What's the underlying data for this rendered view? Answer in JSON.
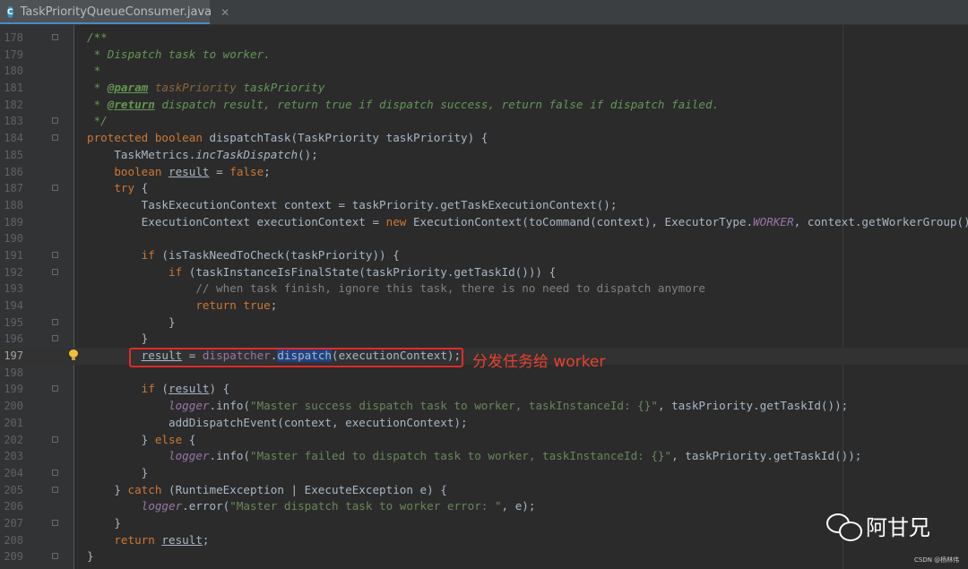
{
  "tab": {
    "icon_letter": "C",
    "file_name": "TaskPriorityQueueConsumer.java",
    "close_glyph": "✕"
  },
  "editor": {
    "current_line": 197,
    "lines": [
      {
        "n": 178,
        "tokens": [
          [
            "doc",
            "/**"
          ]
        ]
      },
      {
        "n": 179,
        "tokens": [
          [
            "doc",
            " * Dispatch task to worker."
          ]
        ]
      },
      {
        "n": 180,
        "tokens": [
          [
            "doc",
            " *"
          ]
        ]
      },
      {
        "n": 181,
        "tokens": [
          [
            "doc",
            " * "
          ],
          [
            "tag",
            "@param"
          ],
          [
            "doc",
            " "
          ],
          [
            "tagval",
            "taskPriority"
          ],
          [
            "doc",
            " taskPriority"
          ]
        ]
      },
      {
        "n": 182,
        "tokens": [
          [
            "doc",
            " * "
          ],
          [
            "tag",
            "@return"
          ],
          [
            "doc",
            " dispatch result, return true if dispatch success, return false if dispatch failed."
          ]
        ]
      },
      {
        "n": 183,
        "tokens": [
          [
            "doc",
            " */"
          ]
        ]
      },
      {
        "n": 184,
        "tokens": [
          [
            "kw",
            "protected boolean "
          ],
          [
            "",
            "dispatchTask(TaskPriority taskPriority) {"
          ]
        ]
      },
      {
        "n": 185,
        "tokens": [
          [
            "",
            "    TaskMetrics."
          ],
          [
            "stat",
            "incTaskDispatch"
          ],
          [
            "",
            "();"
          ]
        ]
      },
      {
        "n": 186,
        "tokens": [
          [
            "kw",
            "    boolean "
          ],
          [
            "u",
            "result"
          ],
          [
            "",
            " = "
          ],
          [
            "kw",
            "false"
          ],
          [
            "",
            ";"
          ]
        ]
      },
      {
        "n": 187,
        "tokens": [
          [
            "kw",
            "    try "
          ],
          [
            "",
            "{"
          ]
        ]
      },
      {
        "n": 188,
        "tokens": [
          [
            "",
            "        TaskExecutionContext context = taskPriority.getTaskExecutionContext();"
          ]
        ]
      },
      {
        "n": 189,
        "tokens": [
          [
            "",
            "        ExecutionContext executionContext = "
          ],
          [
            "kw",
            "new "
          ],
          [
            "",
            "ExecutionContext(toCommand(context), ExecutorType."
          ],
          [
            "enm",
            "WORKER"
          ],
          [
            "",
            ", context.getWorkerGroup());"
          ]
        ]
      },
      {
        "n": 190,
        "tokens": []
      },
      {
        "n": 191,
        "tokens": [
          [
            "kw",
            "        if "
          ],
          [
            "",
            "(isTaskNeedToCheck(taskPriority)) {"
          ]
        ]
      },
      {
        "n": 192,
        "tokens": [
          [
            "kw",
            "            if "
          ],
          [
            "",
            "(taskInstanceIsFinalState(taskPriority.getTaskId())) {"
          ]
        ]
      },
      {
        "n": 193,
        "tokens": [
          [
            "cmt",
            "                // when task finish, ignore this task, there is no need to dispatch anymore"
          ]
        ]
      },
      {
        "n": 194,
        "tokens": [
          [
            "kw",
            "                return true"
          ],
          [
            "",
            ";"
          ]
        ]
      },
      {
        "n": 195,
        "tokens": [
          [
            "",
            "            }"
          ]
        ]
      },
      {
        "n": 196,
        "tokens": [
          [
            "",
            "        }"
          ]
        ]
      },
      {
        "n": 197,
        "tokens": [
          [
            "",
            "        "
          ],
          [
            "u",
            "result"
          ],
          [
            "",
            " = "
          ],
          [
            "fld",
            "dispatcher"
          ],
          [
            "",
            "."
          ],
          [
            "sel",
            "dispatch"
          ],
          [
            "",
            "(executionContext);"
          ]
        ]
      },
      {
        "n": 198,
        "tokens": []
      },
      {
        "n": 199,
        "tokens": [
          [
            "kw",
            "        if "
          ],
          [
            "",
            "("
          ],
          [
            "u",
            "result"
          ],
          [
            "",
            ") {"
          ]
        ]
      },
      {
        "n": 200,
        "tokens": [
          [
            "",
            "            "
          ],
          [
            "enm",
            "logger"
          ],
          [
            "",
            ".info("
          ],
          [
            "str",
            "\"Master success dispatch task to worker, taskInstanceId: {}\""
          ],
          [
            "",
            ", taskPriority.getTaskId());"
          ]
        ]
      },
      {
        "n": 201,
        "tokens": [
          [
            "",
            "            addDispatchEvent(context, executionContext);"
          ]
        ]
      },
      {
        "n": 202,
        "tokens": [
          [
            "",
            "        } "
          ],
          [
            "kw",
            "else "
          ],
          [
            "",
            "{"
          ]
        ]
      },
      {
        "n": 203,
        "tokens": [
          [
            "",
            "            "
          ],
          [
            "enm",
            "logger"
          ],
          [
            "",
            ".info("
          ],
          [
            "str",
            "\"Master failed to dispatch task to worker, taskInstanceId: {}\""
          ],
          [
            "",
            ", taskPriority.getTaskId());"
          ]
        ]
      },
      {
        "n": 204,
        "tokens": [
          [
            "",
            "        }"
          ]
        ]
      },
      {
        "n": 205,
        "tokens": [
          [
            "",
            "    } "
          ],
          [
            "kw",
            "catch "
          ],
          [
            "",
            "(RuntimeException | ExecuteException e) {"
          ]
        ]
      },
      {
        "n": 206,
        "tokens": [
          [
            "",
            "        "
          ],
          [
            "enm",
            "logger"
          ],
          [
            "",
            ".error("
          ],
          [
            "str",
            "\"Master dispatch task to worker error: \""
          ],
          [
            "",
            ", e);"
          ]
        ]
      },
      {
        "n": 207,
        "tokens": [
          [
            "",
            "    }"
          ]
        ]
      },
      {
        "n": 208,
        "tokens": [
          [
            "kw",
            "    return "
          ],
          [
            "u",
            "result"
          ],
          [
            "",
            ";"
          ]
        ]
      },
      {
        "n": 209,
        "tokens": [
          [
            "",
            "}"
          ]
        ]
      }
    ]
  },
  "annotation": {
    "text": "分发任务给 worker"
  },
  "watermark": {
    "brand": "阿甘兄",
    "credit": "CSDN @杨林伟"
  }
}
